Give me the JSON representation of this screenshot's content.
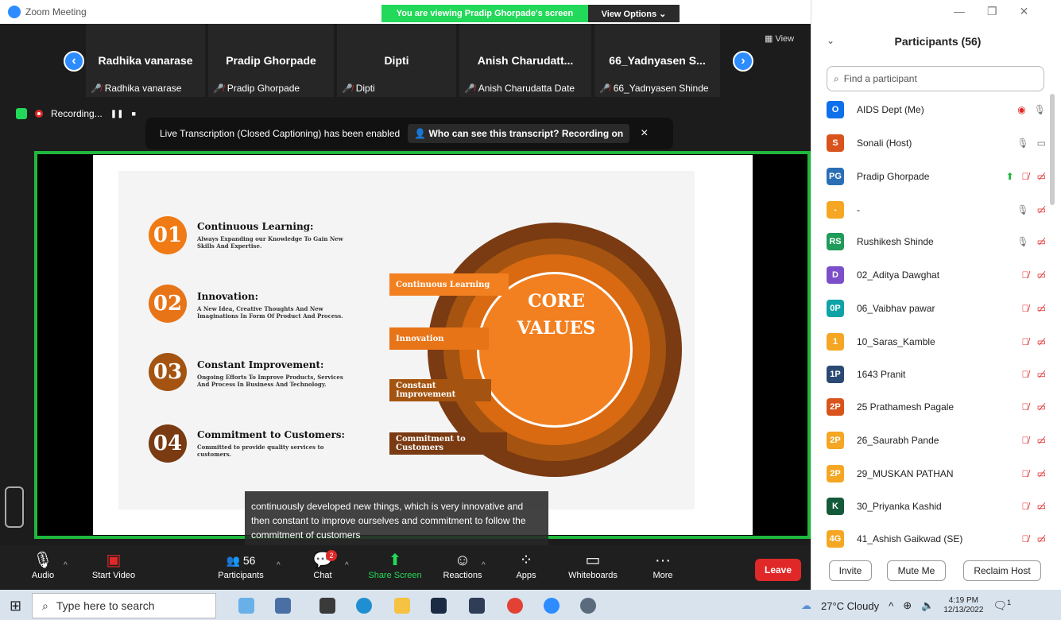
{
  "window": {
    "app_title": "Zoom Meeting",
    "viewing_banner": "You are viewing Pradip Ghorpade's screen",
    "view_options": "View Options ⌄",
    "view_label": "View"
  },
  "thumbs": [
    {
      "name": "Radhika vanarase",
      "label": "Radhika vanarase"
    },
    {
      "name": "Pradip Ghorpade",
      "label": "Pradip Ghorpade"
    },
    {
      "name": "Dipti",
      "label": "Dipti"
    },
    {
      "name": "Anish  Charudatt...",
      "label": "Anish Charudatta Date"
    },
    {
      "name": "66_Yadnyasen S...",
      "label": "66_Yadnyasen Shinde"
    }
  ],
  "recording": {
    "label": "Recording...",
    "pause": "❚❚",
    "stop": "■"
  },
  "transcript": {
    "text": "Live Transcription (Closed Captioning) has been enabled",
    "who": "Who can see this transcript? Recording on",
    "close": "×"
  },
  "slide": {
    "core1": "CORE",
    "core2": "VALUES",
    "items": [
      {
        "num": "01",
        "title": "Continuous Learning:",
        "desc": "Always Expanding our Knowledge To Gain New Skills And Expertise."
      },
      {
        "num": "02",
        "title": "Innovation:",
        "desc": "A New Idea, Creative Thoughts And New Imaginations In Form Of Product And Process."
      },
      {
        "num": "03",
        "title": "Constant Improvement:",
        "desc": "Ongoing Efforts To Improve Products, Services And Process In Business And Technology."
      },
      {
        "num": "04",
        "title": "Commitment to Customers:",
        "desc": "Committed to provide quality services to customers."
      }
    ],
    "bars": [
      "Continuous Learning",
      "Innovation",
      "Constant Improvement",
      "Commitment to Customers"
    ]
  },
  "caption": "continuously developed new things, which is very innovative and then constant to improve ourselves and commitment to follow the commitment of customers",
  "toolbar": {
    "audio": "Audio",
    "video": "Start Video",
    "participants": "Participants",
    "participants_count": "56",
    "chat": "Chat",
    "chat_badge": "2",
    "share": "Share Screen",
    "reactions": "Reactions",
    "apps": "Apps",
    "whiteboards": "Whiteboards",
    "more": "More",
    "leave": "Leave"
  },
  "panel": {
    "title": "Participants (56)",
    "search_placeholder": "Find a participant",
    "people": [
      {
        "initials": "O",
        "color": "#0e71eb",
        "name": "AIDS Dept (Me)"
      },
      {
        "initials": "S",
        "color": "#d9541c",
        "name": "Sonali (Host)"
      },
      {
        "initials": "PG",
        "color": "#2a6fb6",
        "name": "Pradip Ghorpade"
      },
      {
        "initials": "-",
        "color": "#f5a623",
        "name": "-"
      },
      {
        "initials": "RS",
        "color": "#1f9b5a",
        "name": "Rushikesh Shinde"
      },
      {
        "initials": "D",
        "color": "#7b4fc9",
        "name": "02_Aditya Dawghat"
      },
      {
        "initials": "0P",
        "color": "#0fa3a8",
        "name": "06_Vaibhav pawar"
      },
      {
        "initials": "1",
        "color": "#f5a623",
        "name": "10_Saras_Kamble"
      },
      {
        "initials": "1P",
        "color": "#2b4a73",
        "name": "1643 Pranit"
      },
      {
        "initials": "2P",
        "color": "#d9541c",
        "name": "25 Prathamesh Pagale"
      },
      {
        "initials": "2P",
        "color": "#f5a623",
        "name": "26_Saurabh Pande"
      },
      {
        "initials": "2P",
        "color": "#f5a623",
        "name": "29_MUSKAN PATHAN"
      },
      {
        "initials": "K",
        "color": "#145a3a",
        "name": "30_Priyanka Kashid"
      },
      {
        "initials": "4G",
        "color": "#f5a623",
        "name": "41_Ashish Gaikwad (SE)"
      }
    ],
    "invite": "Invite",
    "mute_me": "Mute Me",
    "reclaim": "Reclaim Host"
  },
  "taskbar": {
    "search": "Type here to search",
    "weather": "27°C  Cloudy",
    "time": "4:19 PM",
    "date": "12/13/2022",
    "notif": "1"
  }
}
